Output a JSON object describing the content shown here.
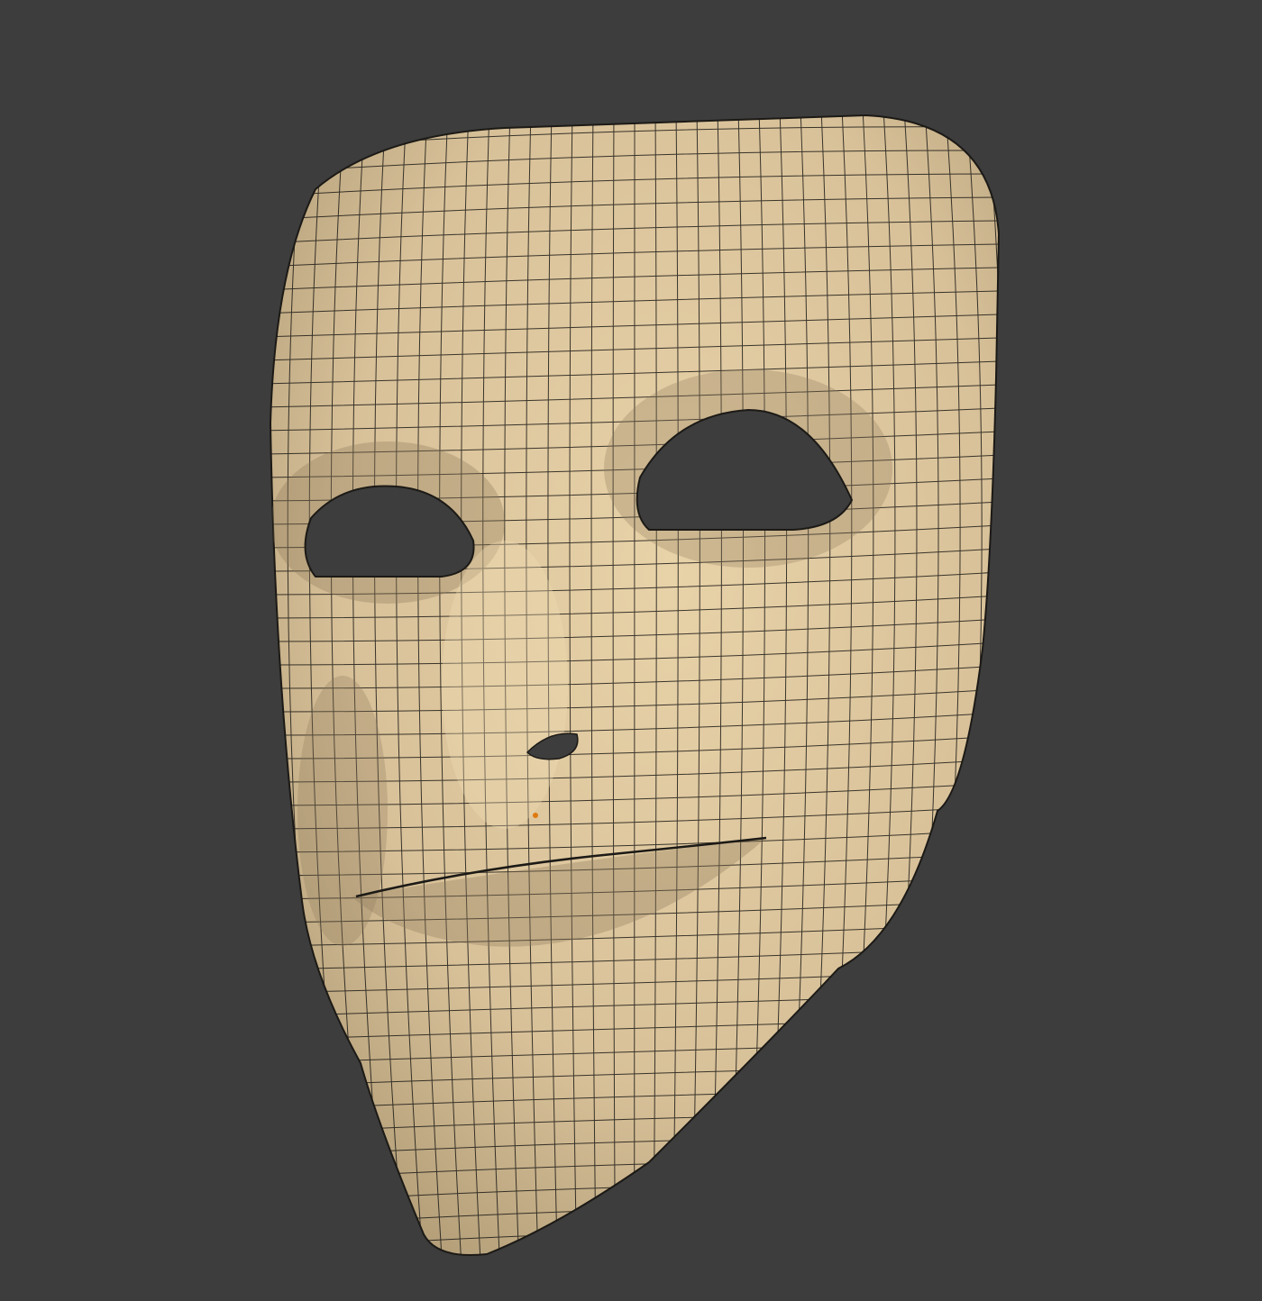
{
  "viewport": {
    "background_color": "#3d3d3d",
    "mask_color": "#d8c199",
    "mask_shadow_color": "#8f7c5c",
    "wire_color": "#1c1a16",
    "selected_vertex_color": "#e07a10"
  }
}
